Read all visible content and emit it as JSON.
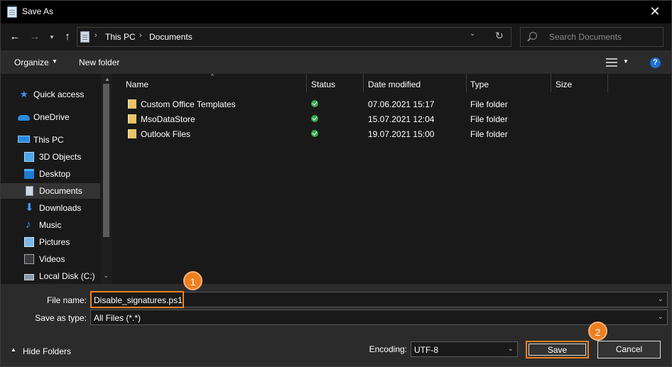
{
  "window": {
    "title": "Save As",
    "close": "✕"
  },
  "nav": {
    "back": "←",
    "forward": "→",
    "recent": "▾",
    "up": "↑",
    "refresh": "↻",
    "addr_dropdown": "⌄"
  },
  "breadcrumb": [
    "This PC",
    "Documents"
  ],
  "search": {
    "placeholder": "Search Documents"
  },
  "toolbar": {
    "organize": "Organize",
    "new_folder": "New folder"
  },
  "sidebar": {
    "items": [
      {
        "label": "Quick access",
        "icon": "star-icon"
      },
      {
        "label": "OneDrive",
        "icon": "cloud-icon"
      },
      {
        "label": "This PC",
        "icon": "computer-icon"
      },
      {
        "label": "3D Objects",
        "icon": "cube-icon"
      },
      {
        "label": "Desktop",
        "icon": "desktop-icon"
      },
      {
        "label": "Documents",
        "icon": "document-icon",
        "active": true
      },
      {
        "label": "Downloads",
        "icon": "download-arrow-icon"
      },
      {
        "label": "Music",
        "icon": "music-note-icon"
      },
      {
        "label": "Pictures",
        "icon": "picture-icon"
      },
      {
        "label": "Videos",
        "icon": "film-icon"
      },
      {
        "label": "Local Disk (C:)",
        "icon": "disk-drive-icon"
      }
    ]
  },
  "columns": [
    "Name",
    "Status",
    "Date modified",
    "Type",
    "Size"
  ],
  "files": [
    {
      "name": "Custom Office Templates",
      "status": "synced",
      "date": "07.06.2021 15:17",
      "type": "File folder",
      "size": ""
    },
    {
      "name": "MsoDataStore",
      "status": "synced",
      "date": "15.07.2021 12:04",
      "type": "File folder",
      "size": ""
    },
    {
      "name": "Outlook Files",
      "status": "synced",
      "date": "19.07.2021 15:00",
      "type": "File folder",
      "size": ""
    }
  ],
  "form": {
    "file_name_label": "File name:",
    "file_name_value": "Disable_signatures.ps1",
    "save_type_label": "Save as type:",
    "save_type_value": "All Files  (*.*)",
    "encoding_label": "Encoding:",
    "encoding_value": "UTF-8"
  },
  "buttons": {
    "save": "Save",
    "cancel": "Cancel",
    "hide_folders": "Hide Folders"
  },
  "callouts": [
    "1",
    "2"
  ],
  "colors": {
    "accent": "#ee7f1f",
    "help": "#1e6fd6",
    "sync_ok": "#37a84a"
  }
}
